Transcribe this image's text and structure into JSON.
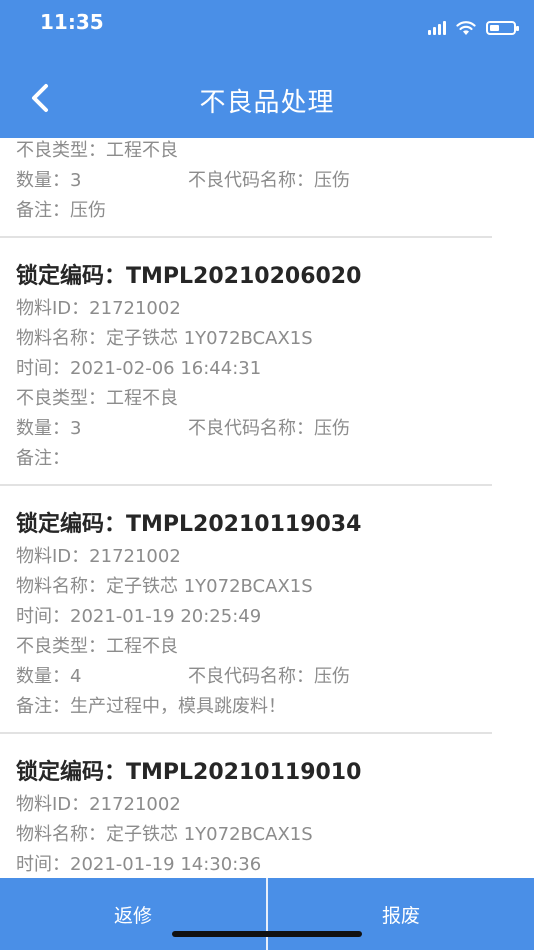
{
  "status": {
    "time": "11:35"
  },
  "header": {
    "title": "不良品处理"
  },
  "records": [
    {
      "code": "",
      "material_id": "",
      "material_name": "",
      "time": "",
      "defect_type": "不良类型：工程不良",
      "quantity": "数量：3",
      "defect_name": "不良代码名称：压伤",
      "remark": "备注：压伤"
    },
    {
      "code": "锁定编码：TMPL20210206020",
      "material_id": "物料ID：21721002",
      "material_name": "物料名称：定子铁芯 1Y072BCAX1S",
      "time": "时间：2021-02-06 16:44:31",
      "defect_type": "不良类型：工程不良",
      "quantity": "数量：3",
      "defect_name": "不良代码名称：压伤",
      "remark": "备注："
    },
    {
      "code": "锁定编码：TMPL20210119034",
      "material_id": "物料ID：21721002",
      "material_name": "物料名称：定子铁芯 1Y072BCAX1S",
      "time": "时间：2021-01-19 20:25:49",
      "defect_type": "不良类型：工程不良",
      "quantity": "数量：4",
      "defect_name": "不良代码名称：压伤",
      "remark": "备注：生产过程中，模具跳废料！"
    },
    {
      "code": "锁定编码：TMPL20210119010",
      "material_id": "物料ID：21721002",
      "material_name": "物料名称：定子铁芯 1Y072BCAX1S",
      "time": "时间：2021-01-19 14:30:36"
    }
  ],
  "footer": {
    "repair_label": "返修",
    "scrap_label": "报废"
  }
}
